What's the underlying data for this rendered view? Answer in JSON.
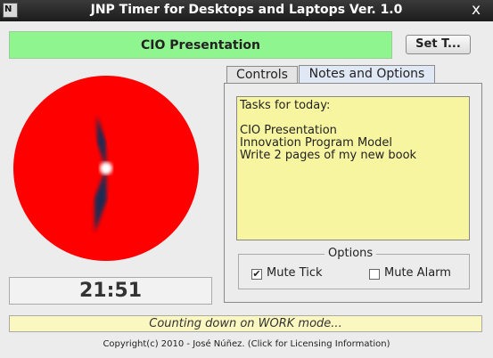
{
  "window": {
    "title": "JNP Timer for Desktops and Laptops Ver. 1.0",
    "app_icon_text": "N",
    "close_glyph": "x"
  },
  "task": {
    "name": "CIO Presentation",
    "set_button_label": "Set T..."
  },
  "clock": {
    "face_color": "#ff0000",
    "hand_color": "#1e2a52",
    "hour_hand_angle_deg": 190,
    "minute_hand_angle_deg": 350
  },
  "time_display": "21:51",
  "tabs": [
    {
      "label": "Controls",
      "active": false
    },
    {
      "label": "Notes and Options",
      "active": true
    }
  ],
  "notes": {
    "lines": [
      "Tasks for today:",
      "",
      "CIO Presentation",
      "Innovation Program Model",
      "Write 2 pages of my new book"
    ]
  },
  "options": {
    "title": "Options",
    "mute_tick": {
      "label": "Mute Tick",
      "checked": true,
      "check_glyph": "✔"
    },
    "mute_alarm": {
      "label": "Mute Alarm",
      "checked": false,
      "check_glyph": ""
    }
  },
  "status_text": "Counting down on WORK mode...",
  "copyright": "Copyright(c) 2010 - José Núñez. (Click for Licensing Information)"
}
